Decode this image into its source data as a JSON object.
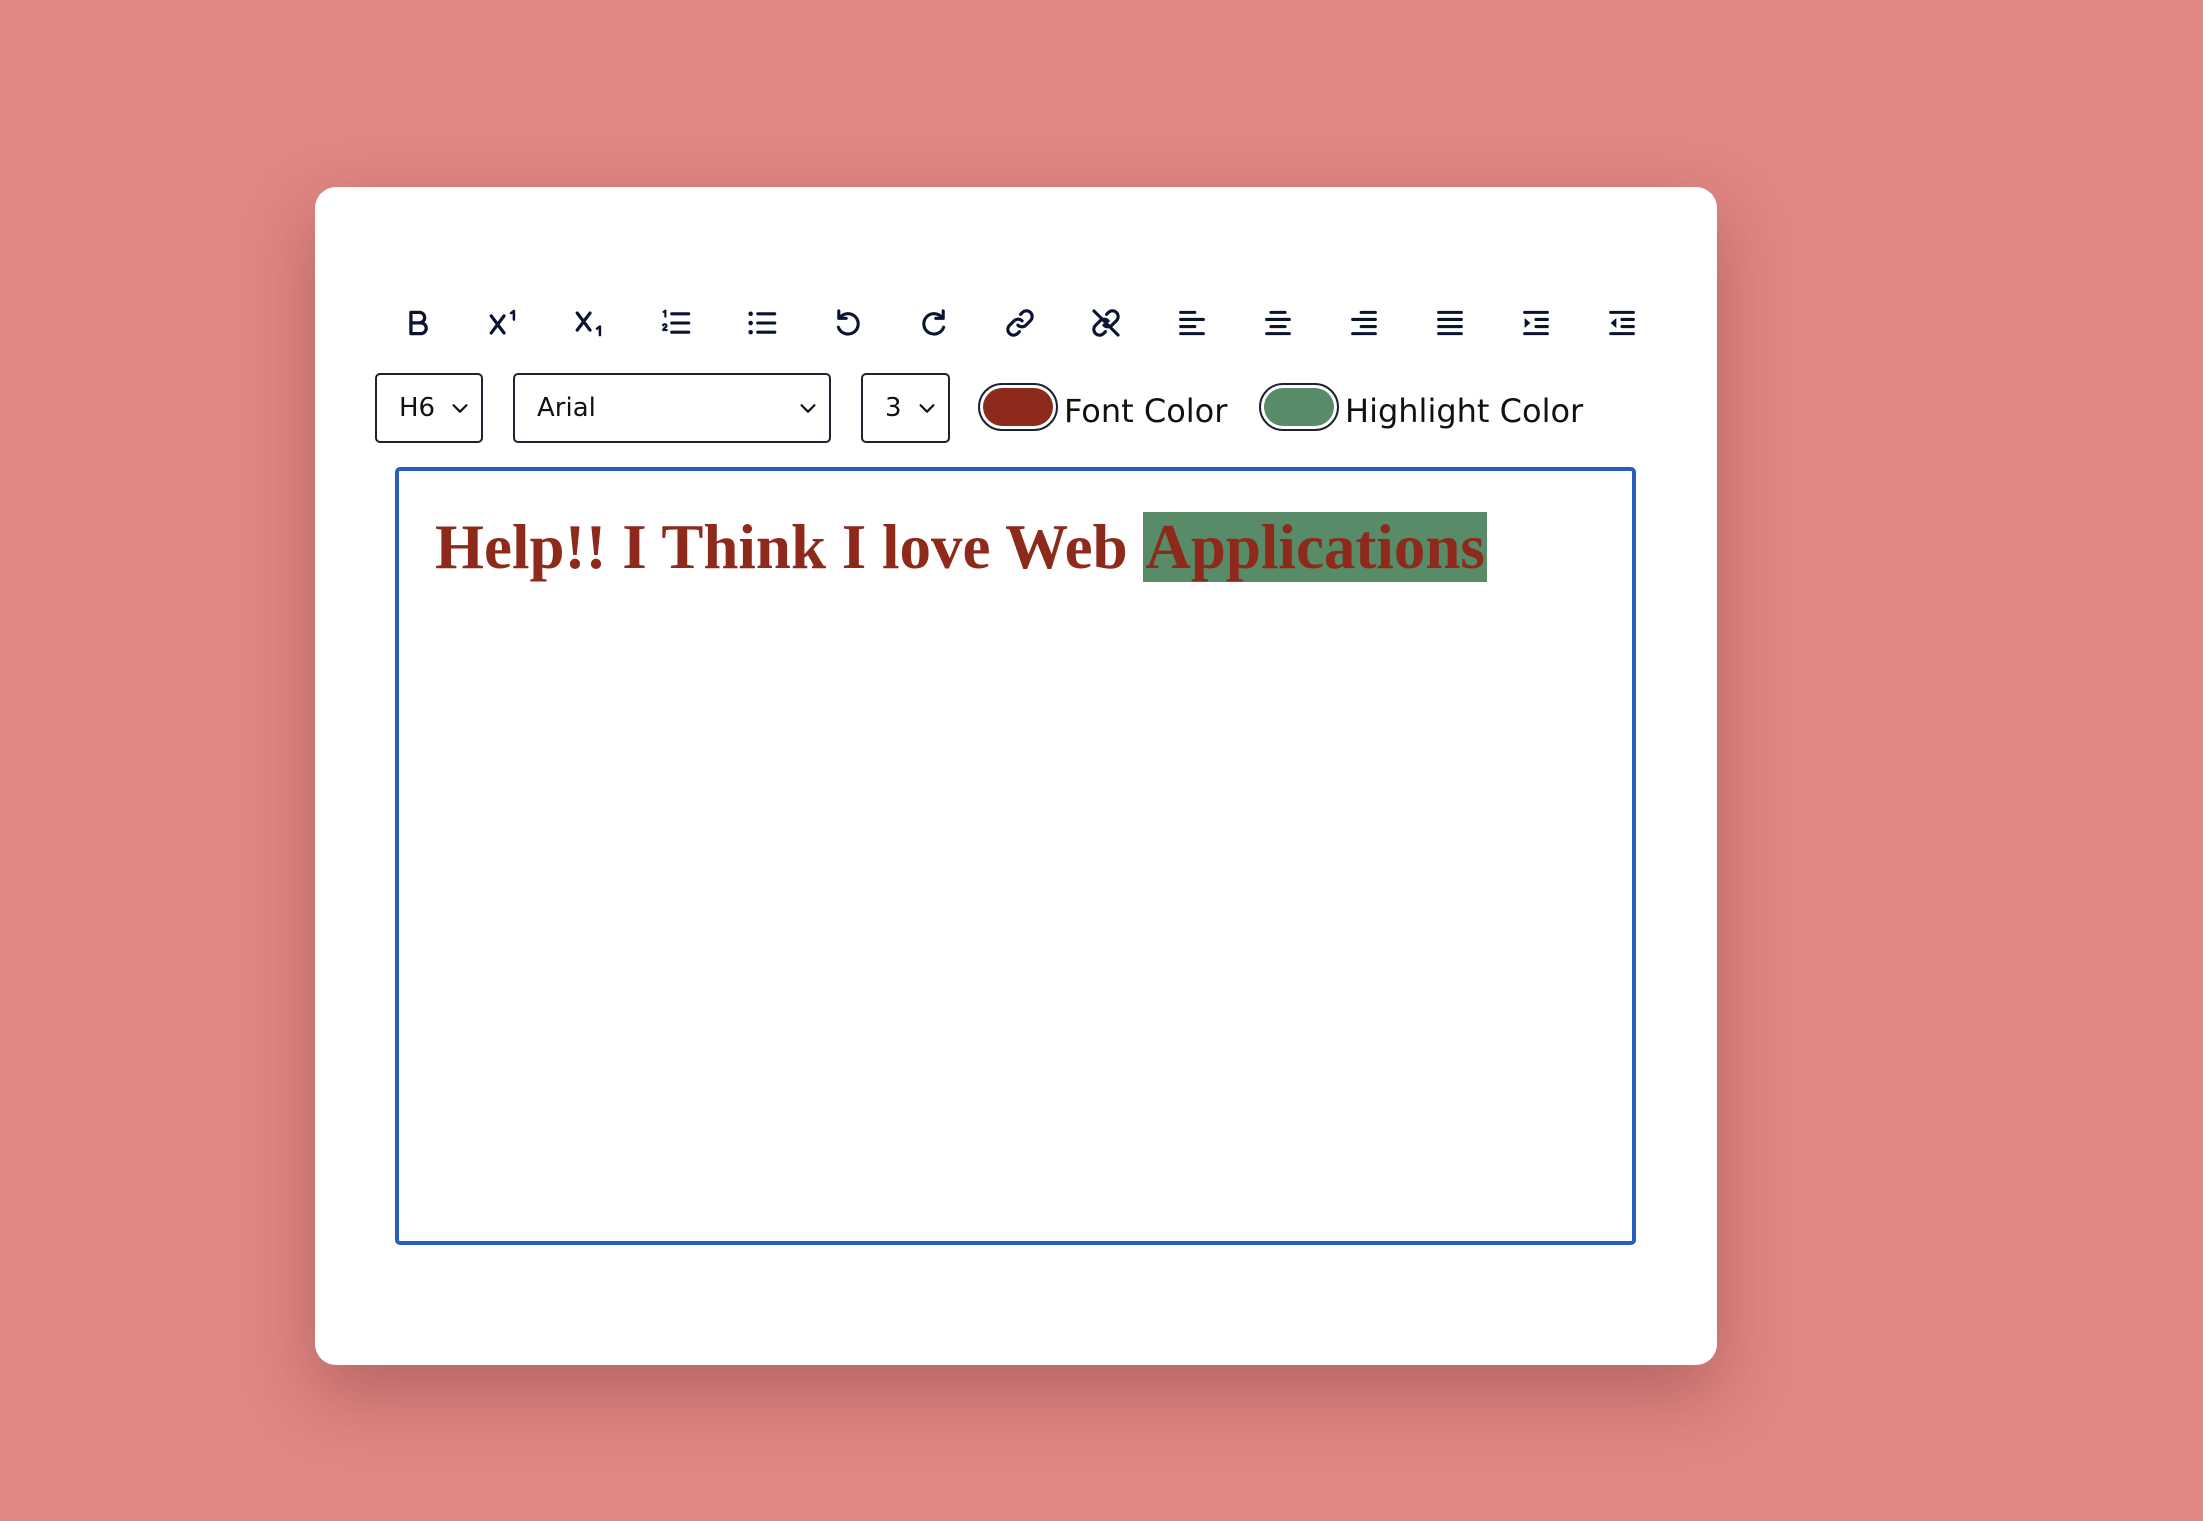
{
  "colors": {
    "page_background": "#e08683",
    "card_background": "#ffffff",
    "icon_color": "#0a1330",
    "editor_border": "#2a5bc0",
    "font_color": "#8e2a1c",
    "highlight_color": "#588b68"
  },
  "toolbar": {
    "buttons": [
      {
        "name": "bold-button",
        "icon": "bold-icon"
      },
      {
        "name": "superscript-button",
        "icon": "superscript-icon"
      },
      {
        "name": "subscript-button",
        "icon": "subscript-icon"
      },
      {
        "name": "ordered-list-button",
        "icon": "ordered-list-icon"
      },
      {
        "name": "unordered-list-button",
        "icon": "unordered-list-icon"
      },
      {
        "name": "undo-button",
        "icon": "undo-icon"
      },
      {
        "name": "redo-button",
        "icon": "redo-icon"
      },
      {
        "name": "link-button",
        "icon": "link-icon"
      },
      {
        "name": "unlink-button",
        "icon": "unlink-icon"
      },
      {
        "name": "align-left-button",
        "icon": "align-left-icon"
      },
      {
        "name": "align-center-button",
        "icon": "align-center-icon"
      },
      {
        "name": "align-right-button",
        "icon": "align-right-icon"
      },
      {
        "name": "justify-button",
        "icon": "justify-icon"
      },
      {
        "name": "indent-button",
        "icon": "indent-icon"
      },
      {
        "name": "outdent-button",
        "icon": "outdent-icon"
      }
    ]
  },
  "controls": {
    "heading_select": {
      "value": "H6",
      "icon": "chevron-down-icon"
    },
    "font_select": {
      "value": "Arial",
      "icon": "chevron-down-icon"
    },
    "size_select": {
      "value": "3",
      "icon": "chevron-down-icon"
    },
    "font_color": {
      "label": "Font Color"
    },
    "highlight_color": {
      "label": "Highlight Color"
    }
  },
  "editor": {
    "text_plain": "Help!! I Think I love Web ",
    "text_highlighted": "Applications"
  }
}
